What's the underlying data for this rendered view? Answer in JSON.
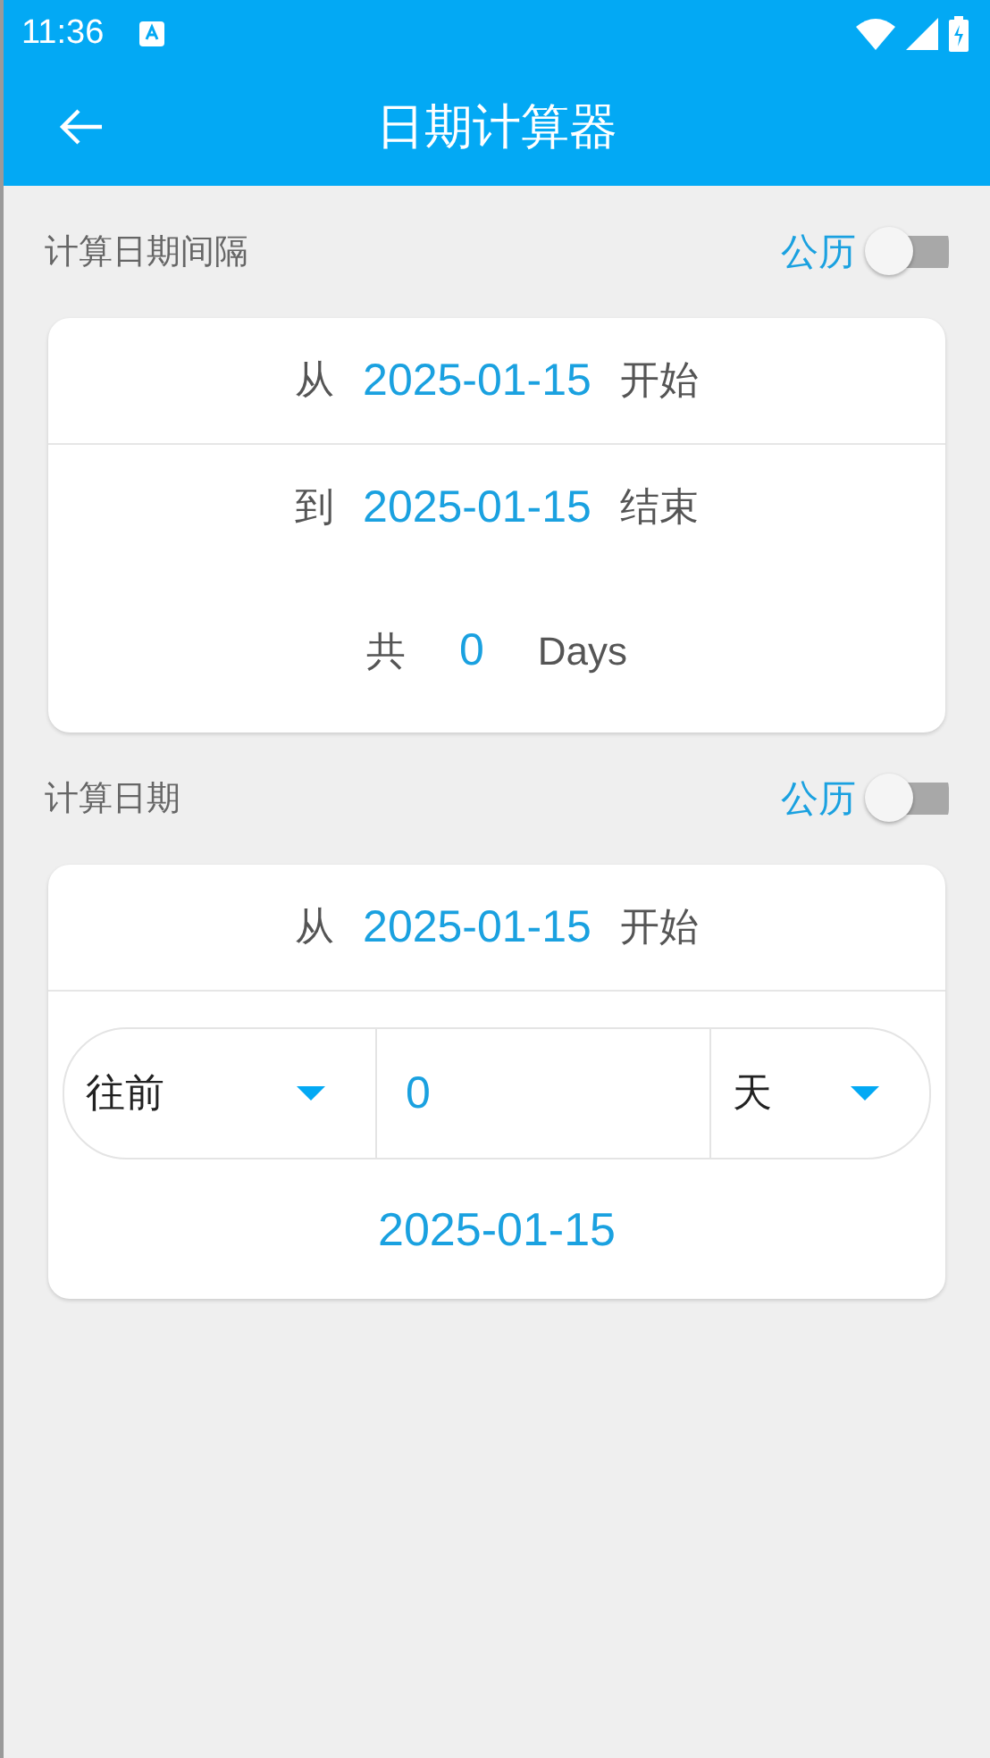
{
  "status_bar": {
    "time": "11:36"
  },
  "app_bar": {
    "title": "日期计算器"
  },
  "interval": {
    "title": "计算日期间隔",
    "calendar_label": "公历",
    "calendar_on": false,
    "rows": [
      {
        "prefix": "从",
        "date": "2025-01-15",
        "suffix": "开始"
      },
      {
        "prefix": "到",
        "date": "2025-01-15",
        "suffix": "结束"
      }
    ],
    "total": {
      "prefix": "共",
      "value": "0",
      "unit": "Days"
    }
  },
  "calculate": {
    "title": "计算日期",
    "calendar_label": "公历",
    "calendar_on": false,
    "start": {
      "prefix": "从",
      "date": "2025-01-15",
      "suffix": "开始"
    },
    "direction": "往前",
    "amount": "0",
    "unit": "天",
    "result": "2025-01-15"
  }
}
